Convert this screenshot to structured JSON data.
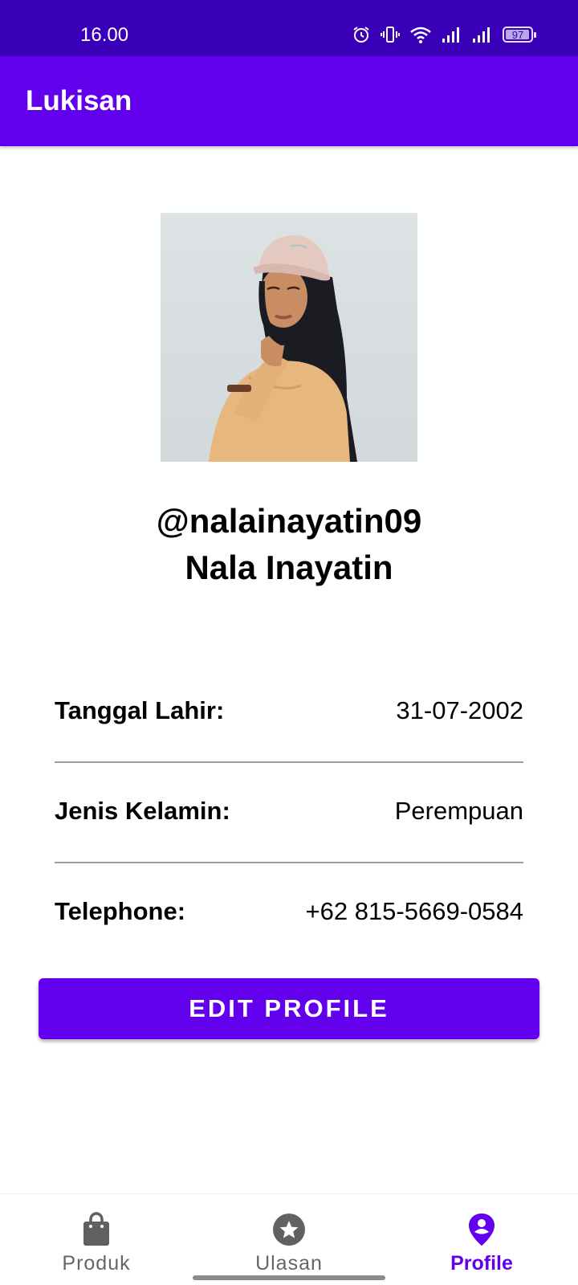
{
  "status_bar": {
    "time": "16.00",
    "battery_level": "97",
    "icons": [
      "alarm-icon",
      "vibrate-icon",
      "wifi-icon",
      "signal-icon",
      "signal-icon",
      "battery-icon"
    ]
  },
  "app_bar": {
    "title": "Lukisan"
  },
  "profile": {
    "handle": "@nalainayatin09",
    "name": "Nala Inayatin",
    "photo_icon": "profile-photo"
  },
  "info": [
    {
      "label": "Tanggal Lahir:",
      "value": "31-07-2002"
    },
    {
      "label": "Jenis Kelamin:",
      "value": "Perempuan"
    },
    {
      "label": "Telephone:",
      "value": "+62 815-5669-0584"
    }
  ],
  "edit_button": {
    "label": "EDIT PROFILE"
  },
  "bottom_nav": {
    "items": [
      {
        "label": "Produk",
        "icon": "shopping-bag-icon",
        "active": false
      },
      {
        "label": "Ulasan",
        "icon": "star-icon",
        "active": false
      },
      {
        "label": "Profile",
        "icon": "location-pin-icon",
        "active": true
      }
    ]
  },
  "colors": {
    "status_bar": "#3a00b8",
    "primary": "#6200ee",
    "inactive_nav": "#666666"
  }
}
